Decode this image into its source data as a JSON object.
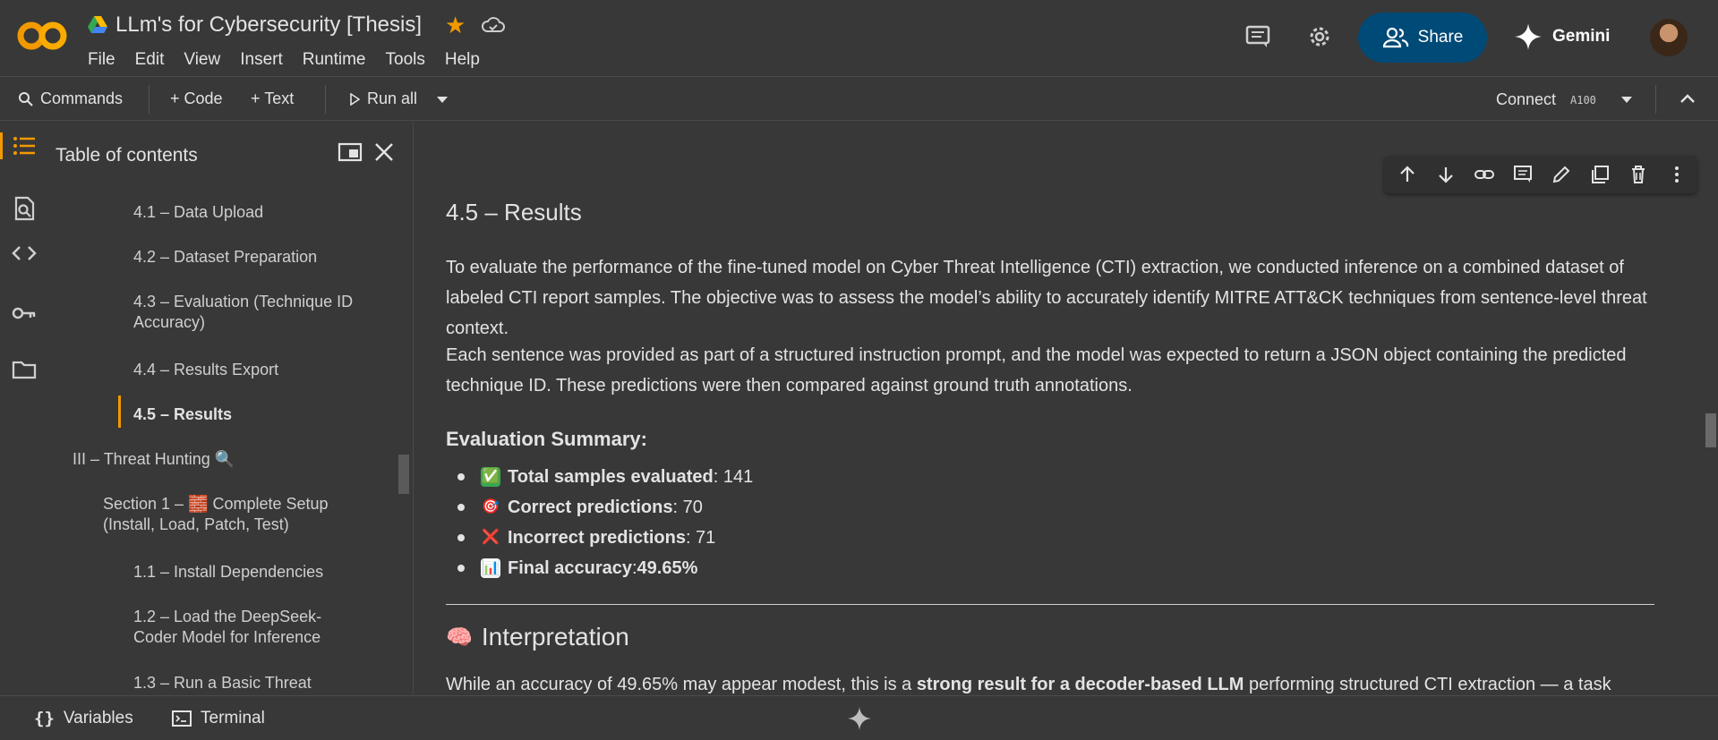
{
  "header": {
    "title": "LLm's for Cybersecurity [Thesis]",
    "menu": [
      "File",
      "Edit",
      "View",
      "Insert",
      "Runtime",
      "Tools",
      "Help"
    ],
    "share_label": "Share",
    "gemini_label": "Gemini"
  },
  "toolbar": {
    "commands_label": "Commands",
    "code_label": "+ Code",
    "text_label": "+ Text",
    "run_all_label": "Run all",
    "connect_label": "Connect",
    "runtime_type": "A100"
  },
  "toc": {
    "header": "Table of contents",
    "items": [
      {
        "label": "4.1 – Data Upload"
      },
      {
        "label": "4.2 – Dataset Preparation"
      },
      {
        "label": "4.3 – Evaluation (Technique ID Accuracy)"
      },
      {
        "label": "4.4 – Results Export"
      },
      {
        "label": "4.5 – Results"
      },
      {
        "label": "III – Threat Hunting 🔍"
      },
      {
        "label": "Section 1 – 🧱 Complete Setup (Install, Load, Patch, Test)"
      },
      {
        "label": "1.1 – Install Dependencies"
      },
      {
        "label": "1.2 – Load the DeepSeek-Coder Model for Inference"
      },
      {
        "label": "1.3 – Run a Basic Threat"
      }
    ]
  },
  "cell": {
    "heading": "4.5 – Results",
    "para1": "To evaluate the performance of the fine-tuned model on Cyber Threat Intelligence (CTI) extraction, we conducted inference on a combined dataset of labeled CTI report samples. The objective was to assess the model’s ability to accurately identify MITRE ATT&CK techniques from sentence-level threat context.",
    "para2": "Each sentence was provided as part of a structured instruction prompt, and the model was expected to return a JSON object containing the predicted technique ID. These predictions were then compared against ground truth annotations.",
    "summary_heading": "Evaluation Summary:",
    "bullets": [
      {
        "emoji": "✅",
        "label": "Total samples evaluated",
        "value": ": 141"
      },
      {
        "emoji": "🎯",
        "label": "Correct predictions",
        "value": ": 70"
      },
      {
        "emoji": "❌",
        "label": "Incorrect predictions",
        "value": ": 71"
      },
      {
        "emoji": "📊",
        "label": "Final accuracy",
        "value": ": ",
        "bold_value": "49.65%"
      }
    ],
    "interp_emoji": "🧠",
    "interp_heading": "Interpretation",
    "para3_a": "While an accuracy of 49.65% may appear modest, this is a ",
    "para3_b": "strong result for a decoder-based LLM",
    "para3_c": " performing structured CTI extraction — a task typically dominated by encoder-based classifiers."
  },
  "bottom": {
    "variables_label": "Variables",
    "terminal_label": "Terminal"
  },
  "colors": {
    "accent": "#f29900",
    "share_bg": "#004a77",
    "background": "#383838"
  }
}
